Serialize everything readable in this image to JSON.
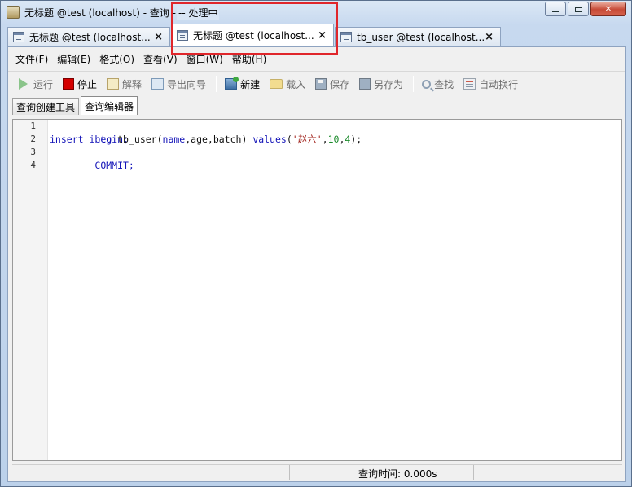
{
  "window": {
    "title": "无标题 @test (localhost) - 查询 -",
    "processing_text": "-- 处理中"
  },
  "doc_tabs": [
    {
      "label": "无标题 @test (localhost...",
      "close": "×"
    },
    {
      "label": "无标题 @test (localhost...",
      "close": "×"
    },
    {
      "label": "tb_user @test (localhost...",
      "close": "×"
    }
  ],
  "menu": {
    "items": [
      "文件(F)",
      "编辑(E)",
      "格式(O)",
      "查看(V)",
      "窗口(W)",
      "帮助(H)"
    ]
  },
  "toolbar": {
    "run": "运行",
    "stop": "停止",
    "explain": "解释",
    "export": "导出向导",
    "new": "新建",
    "load": "载入",
    "save": "保存",
    "save_as": "另存为",
    "find": "查找",
    "word_wrap": "自动换行"
  },
  "subtabs": {
    "builder": "查询创建工具",
    "editor": "查询编辑器"
  },
  "editor": {
    "line_numbers": [
      "1",
      "2",
      "3",
      "4"
    ],
    "line1": {
      "kw": "begin;"
    },
    "line2": {
      "kw1": "insert",
      "kw2": "into",
      "table": "tb_user(",
      "col1": "name",
      "rest_cols": ",age,batch) ",
      "values": "values",
      "open": "(",
      "str": "'赵六'",
      "comma1": ",",
      "n1": "10",
      "comma2": ",",
      "n2": "4",
      "close": ");"
    },
    "line3": {
      "kw": "COMMIT;"
    }
  },
  "status": {
    "query_time": "查询时间: 0.000s"
  }
}
